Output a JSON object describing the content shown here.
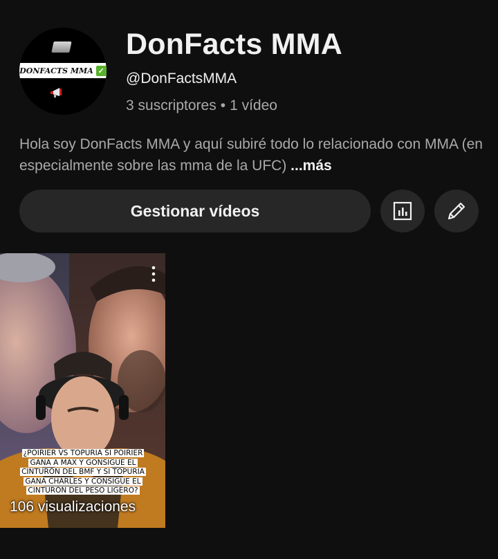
{
  "channel": {
    "title": "DonFacts MMA",
    "handle": "@DonFactsMMA",
    "subscribers": "3 suscriptores",
    "separator": "•",
    "videos": "1 vídeo",
    "description": "Hola soy DonFacts MMA y aquí subiré todo lo relacionado con MMA (en especialmente sobre las mma de la UFC)",
    "more_label": "...más",
    "avatar_text": "DONFACTS MMA"
  },
  "actions": {
    "manage_videos": "Gestionar vídeos",
    "analytics_icon": "bar-chart-icon",
    "edit_icon": "pencil-icon"
  },
  "video": {
    "caption": "¿POIRIER VS TOPURIA SI POIRIER GANA A MAX Y GONSIGUE EL CINTURÓN DEL BMF Y SI TOPURIA GANA  CHARLES Y CONSIGUE EL CINTURÓN DEL PESO LIGERO?",
    "views": "106 visualizaciones"
  },
  "colors": {
    "background": "#0f0f0f",
    "button_bg": "#272727",
    "secondary_text": "#aaaaaa"
  }
}
